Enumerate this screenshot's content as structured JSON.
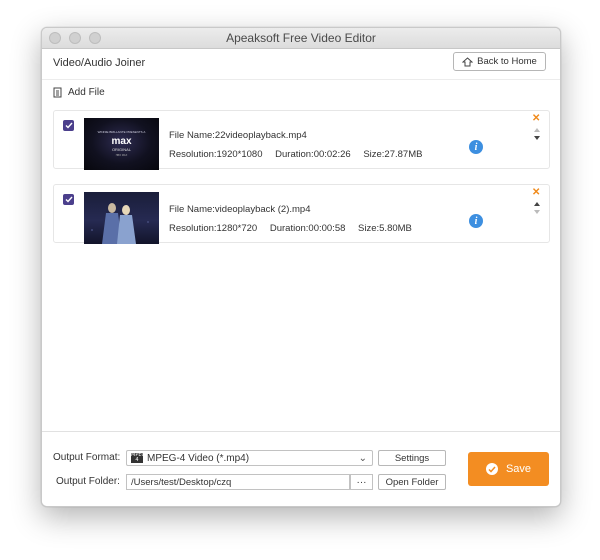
{
  "window": {
    "title": "Apeaksoft Free Video Editor"
  },
  "header": {
    "title": "Video/Audio Joiner",
    "back_label": "Back to Home"
  },
  "toolbar": {
    "add_file_label": "Add File"
  },
  "files": [
    {
      "name": "File Name:22videoplayback.mp4",
      "resolution": "Resolution:1920*1080",
      "duration": "Duration:00:02:26",
      "size": "Size:27.87MB",
      "checked": true
    },
    {
      "name": "File Name:videoplayback (2).mp4",
      "resolution": "Resolution:1280*720",
      "duration": "Duration:00:00:58",
      "size": "Size:5.80MB",
      "checked": true
    }
  ],
  "thumb1": {
    "top_text": "WINNIE BRILLANTE PRESENTS A",
    "brand": "max",
    "sub": "ORIGINAL",
    "small": "HBO MAX"
  },
  "output": {
    "format_label": "Output Format:",
    "format_value": "MPEG-4 Video (*.mp4)",
    "format_icon_text": "MPEG 4",
    "settings_label": "Settings",
    "folder_label": "Output Folder:",
    "folder_value": "/Users/test/Desktop/czq",
    "browse_label": "···",
    "open_folder_label": "Open Folder"
  },
  "save_label": "Save",
  "colors": {
    "accent": "#f38d22",
    "checkbox": "#4b3f8c",
    "info": "#3d8fe0"
  }
}
